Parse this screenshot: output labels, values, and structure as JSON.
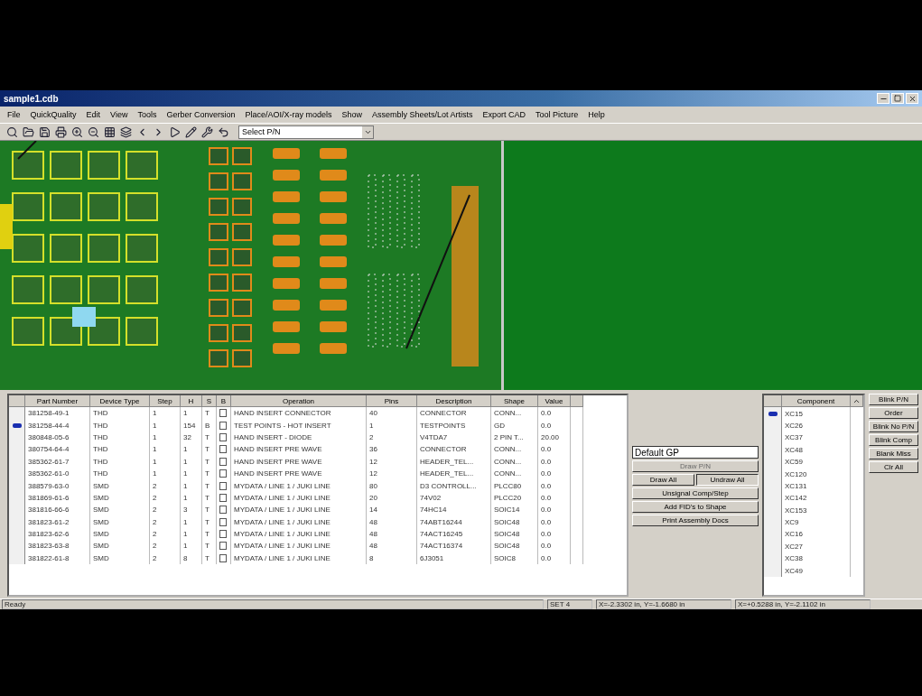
{
  "window": {
    "title": "sample1.cdb"
  },
  "menu": [
    "File",
    "QuickQuality",
    "Edit",
    "View",
    "Tools",
    "Gerber Conversion",
    "Place/AOI/X-ray models",
    "Show",
    "Assembly Sheets/Lot Artists",
    "Export CAD",
    "Tool Picture",
    "Help"
  ],
  "toolbar": {
    "select": {
      "value": "Select P/N"
    }
  },
  "table": {
    "columns": [
      "Part Number",
      "Device Type",
      "Step",
      "H",
      "S",
      "Operation",
      "Pins",
      "Description",
      "Shape",
      "Value"
    ],
    "checkbox_column": "B",
    "rows": [
      {
        "selected": false,
        "checked": false,
        "cells": [
          "381258-49-1",
          "THD",
          "1",
          "1",
          "T",
          "HAND INSERT CONNECTOR",
          "40",
          "CONNECTOR",
          "CONN...",
          "0.0"
        ]
      },
      {
        "selected": true,
        "checked": false,
        "cells": [
          "381258-44-4",
          "THD",
          "1",
          "154",
          "B",
          "TEST POINTS - HOT INSERT",
          "1",
          "TESTPOINTS",
          "GD",
          "0.0"
        ]
      },
      {
        "selected": false,
        "checked": false,
        "cells": [
          "380848-05-6",
          "THD",
          "1",
          "32",
          "T",
          "HAND INSERT - DIODE",
          "2",
          "V4TDA7",
          "2 PIN T...",
          "20.00"
        ]
      },
      {
        "selected": false,
        "checked": false,
        "cells": [
          "380754-64-4",
          "THD",
          "1",
          "1",
          "T",
          "HAND INSERT PRE WAVE",
          "36",
          "CONNECTOR",
          "CONN...",
          "0.0"
        ]
      },
      {
        "selected": false,
        "checked": false,
        "cells": [
          "385362-61-7",
          "THD",
          "1",
          "1",
          "T",
          "HAND INSERT PRE WAVE",
          "12",
          "HEADER_TEL...",
          "CONN...",
          "0.0"
        ]
      },
      {
        "selected": false,
        "checked": false,
        "cells": [
          "385362-61-0",
          "THD",
          "1",
          "1",
          "T",
          "HAND INSERT PRE WAVE",
          "12",
          "HEADER_TEL...",
          "CONN...",
          "0.0"
        ]
      },
      {
        "selected": false,
        "checked": false,
        "cells": [
          "388579-63-0",
          "SMD",
          "2",
          "1",
          "T",
          "MYDATA / LINE 1 / JUKI LINE",
          "80",
          "D3 CONTROLL...",
          "PLCC80",
          "0.0"
        ]
      },
      {
        "selected": false,
        "checked": false,
        "cells": [
          "381869-61-6",
          "SMD",
          "2",
          "1",
          "T",
          "MYDATA / LINE 1 / JUKI LINE",
          "20",
          "74V02",
          "PLCC20",
          "0.0"
        ]
      },
      {
        "selected": false,
        "checked": false,
        "cells": [
          "381816-66-6",
          "SMD",
          "2",
          "3",
          "T",
          "MYDATA / LINE 1 / JUKI LINE",
          "14",
          "74HC14",
          "SOIC14",
          "0.0"
        ]
      },
      {
        "selected": false,
        "checked": false,
        "cells": [
          "381823-61-2",
          "SMD",
          "2",
          "1",
          "T",
          "MYDATA / LINE 1 / JUKI LINE",
          "48",
          "74ABT16244",
          "SOIC48",
          "0.0"
        ]
      },
      {
        "selected": false,
        "checked": false,
        "cells": [
          "381823-62-6",
          "SMD",
          "2",
          "1",
          "T",
          "MYDATA / LINE 1 / JUKI LINE",
          "48",
          "74ACT16245",
          "SOIC48",
          "0.0"
        ]
      },
      {
        "selected": false,
        "checked": false,
        "cells": [
          "381823-63-8",
          "SMD",
          "2",
          "1",
          "T",
          "MYDATA / LINE 1 / JUKI LINE",
          "48",
          "74ACT16374",
          "SOIC48",
          "0.0"
        ]
      },
      {
        "selected": false,
        "checked": false,
        "cells": [
          "381822-61-8",
          "SMD",
          "2",
          "8",
          "T",
          "MYDATA / LINE 1 / JUKI LINE",
          "8",
          "6J3051",
          "SOIC8",
          "0.0"
        ]
      }
    ]
  },
  "controls": {
    "gp_field": {
      "value": "Default GP"
    },
    "disabled_button": {
      "label": "Draw P/N",
      "disabled": true
    },
    "draw_buttons": [
      {
        "label": "Draw All",
        "selected": false
      },
      {
        "label": "Undraw All",
        "selected": true
      }
    ],
    "buttons": [
      "Unsignal Comp/Step",
      "Add FID's to Shape",
      "Print Assembly Docs"
    ]
  },
  "components": {
    "column": "Component",
    "items": [
      {
        "label": "XC15",
        "selected": true
      },
      {
        "label": "XC26",
        "selected": false
      },
      {
        "label": "XC37",
        "selected": false
      },
      {
        "label": "XC48",
        "selected": false
      },
      {
        "label": "XC59",
        "selected": false
      },
      {
        "label": "XC120",
        "selected": false
      },
      {
        "label": "XC131",
        "selected": false
      },
      {
        "label": "XC142",
        "selected": false
      },
      {
        "label": "XC153",
        "selected": false
      },
      {
        "label": "XC9",
        "selected": false
      },
      {
        "label": "XC16",
        "selected": false
      },
      {
        "label": "XC27",
        "selected": false
      },
      {
        "label": "XC38",
        "selected": false
      },
      {
        "label": "XC49",
        "selected": false
      }
    ]
  },
  "side_buttons": [
    "Blink P/N",
    "Order",
    "Blink No P/N",
    "Blink Comp",
    "Blank Miss",
    "Clr All"
  ],
  "status_bar": [
    "Ready",
    "SET 4",
    "X=-2.3302 in, Y=-1.6680 in",
    "X=+0.5288 in, Y=-2.1102 in"
  ]
}
